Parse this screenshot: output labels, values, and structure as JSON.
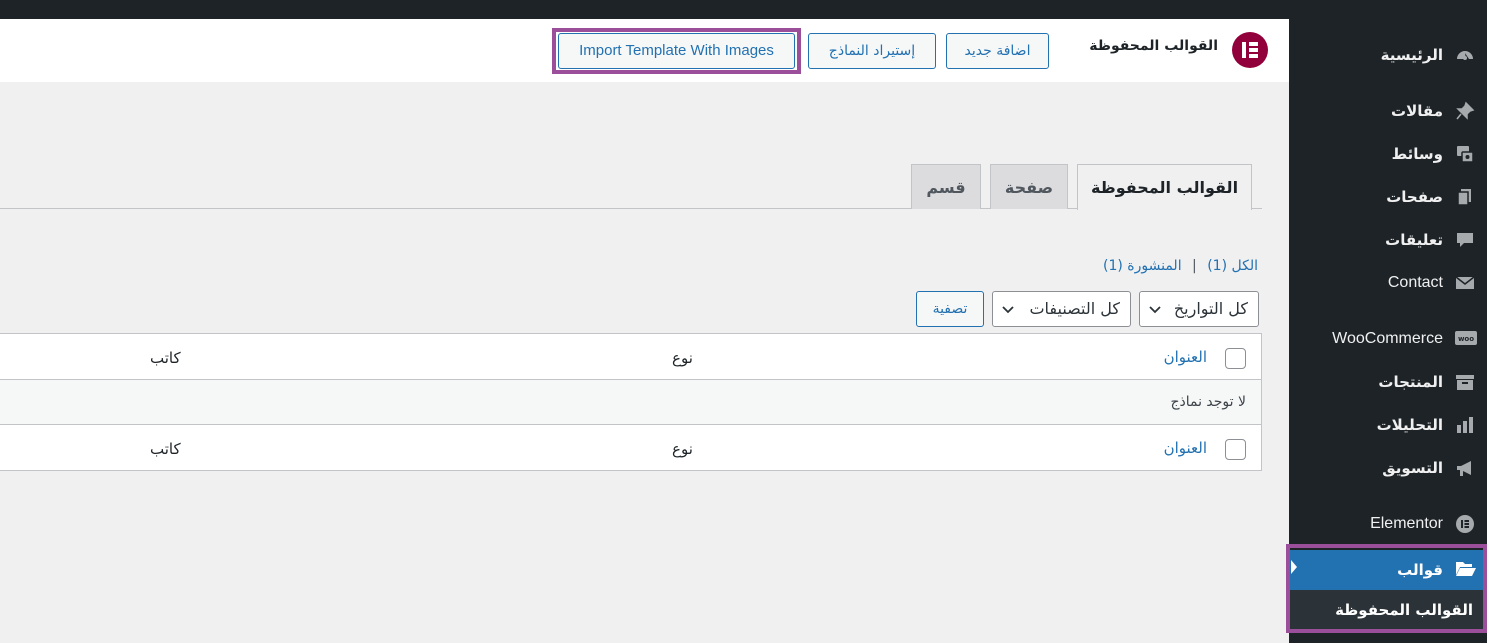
{
  "sidebar": {
    "items": [
      {
        "label": "الرئيسية",
        "icon": "dashboard-icon"
      },
      {
        "label": "مقالات",
        "icon": "pin-icon"
      },
      {
        "label": "وسائط",
        "icon": "media-icon"
      },
      {
        "label": "صفحات",
        "icon": "pages-icon"
      },
      {
        "label": "تعليقات",
        "icon": "comment-icon"
      },
      {
        "label": "Contact",
        "icon": "envelope-icon"
      },
      {
        "label": "WooCommerce",
        "icon": "woo-icon"
      },
      {
        "label": "المنتجات",
        "icon": "archive-icon"
      },
      {
        "label": "التحليلات",
        "icon": "bar-chart-icon"
      },
      {
        "label": "التسويق",
        "icon": "megaphone-icon"
      },
      {
        "label": "Elementor",
        "icon": "elementor-icon"
      },
      {
        "label": "قوالب",
        "icon": "folder-open-icon"
      }
    ],
    "submenu": {
      "label": "القوالب المحفوظة"
    },
    "active_item": "قوالب"
  },
  "header": {
    "title": "القوالب المحفوظة",
    "add_new_label": "اضافة جديد",
    "import_label": "إستيراد النماذج",
    "import_images_label": "Import Template With Images",
    "logo_icon": "elementor-logo-icon"
  },
  "tabs": [
    {
      "label": "القوالب المحفوظة",
      "active": true
    },
    {
      "label": "صفحة",
      "active": false
    },
    {
      "label": "قسم",
      "active": false
    }
  ],
  "views": {
    "all_label": "الكل (1)",
    "separator": "|",
    "published_label": "المنشورة (1)"
  },
  "filters": {
    "dates_selected": "كل التواريخ",
    "categories_selected": "كل التصنيفات",
    "filter_button": "تصفية"
  },
  "table": {
    "columns": {
      "title": "العنوان",
      "type": "نوع",
      "author": "كاتب"
    },
    "empty_message": "لا توجد نماذج"
  },
  "colors": {
    "accent": "#2271b1",
    "sidebar_bg": "#1d2327",
    "highlight": "#9b4f9b",
    "elementor_brand": "#92003b"
  }
}
